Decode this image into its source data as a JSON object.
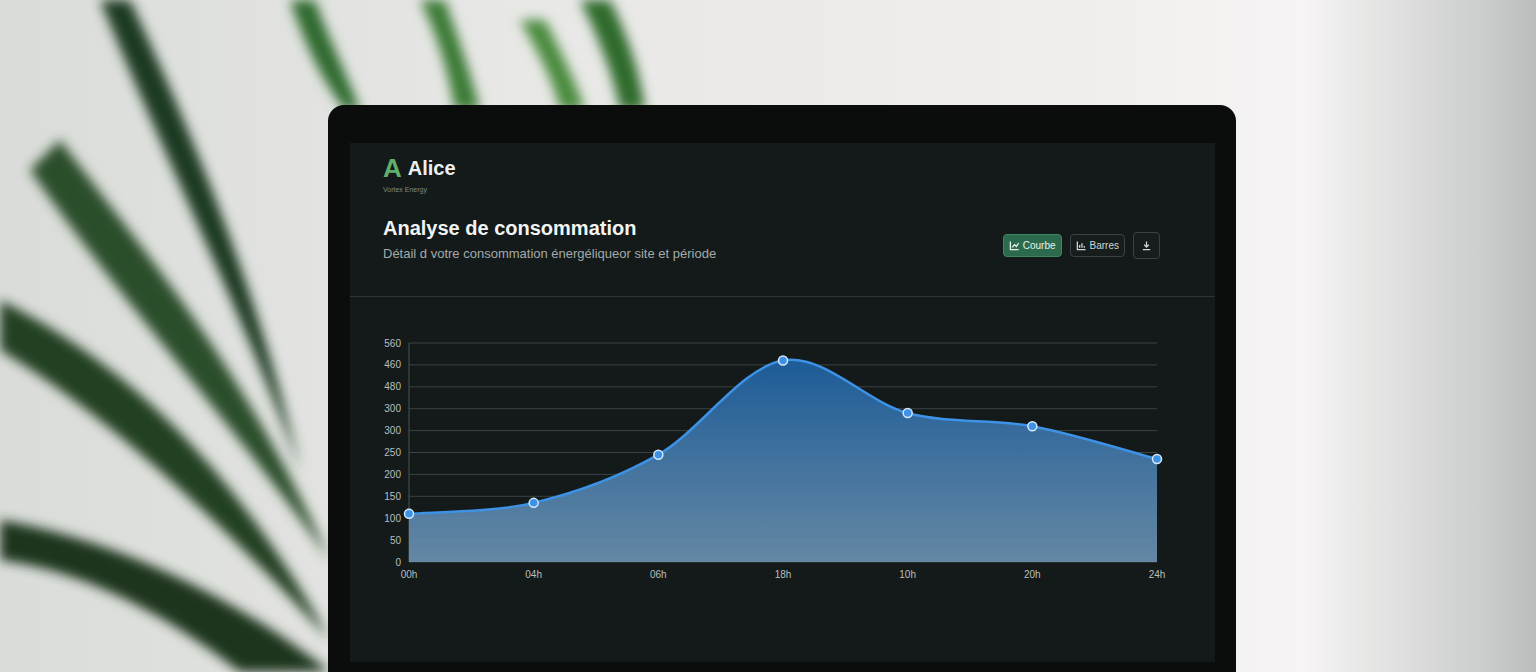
{
  "app": {
    "logo_letter": "A",
    "name": "Alice",
    "tagline": "Vortex Energy"
  },
  "page": {
    "title": "Analyse de consommation",
    "subtitle": "Détail d votre consommation énergéliqueor site et période"
  },
  "view_buttons": [
    {
      "label": "Courbe",
      "kind": "line",
      "selected": true
    },
    {
      "label": "Barres",
      "kind": "bars",
      "selected": false
    }
  ],
  "chart": {
    "y_ticks": [
      "560",
      "460",
      "480",
      "300",
      "300",
      "250",
      "200",
      "150",
      "100",
      "50",
      "0"
    ],
    "x_ticks": [
      "00h",
      "04h",
      "06h",
      "18h",
      "10h",
      "20h",
      "24h"
    ],
    "series": [
      {
        "values": [
          110,
          135,
          245,
          460,
          340,
          310,
          235
        ]
      }
    ]
  }
}
